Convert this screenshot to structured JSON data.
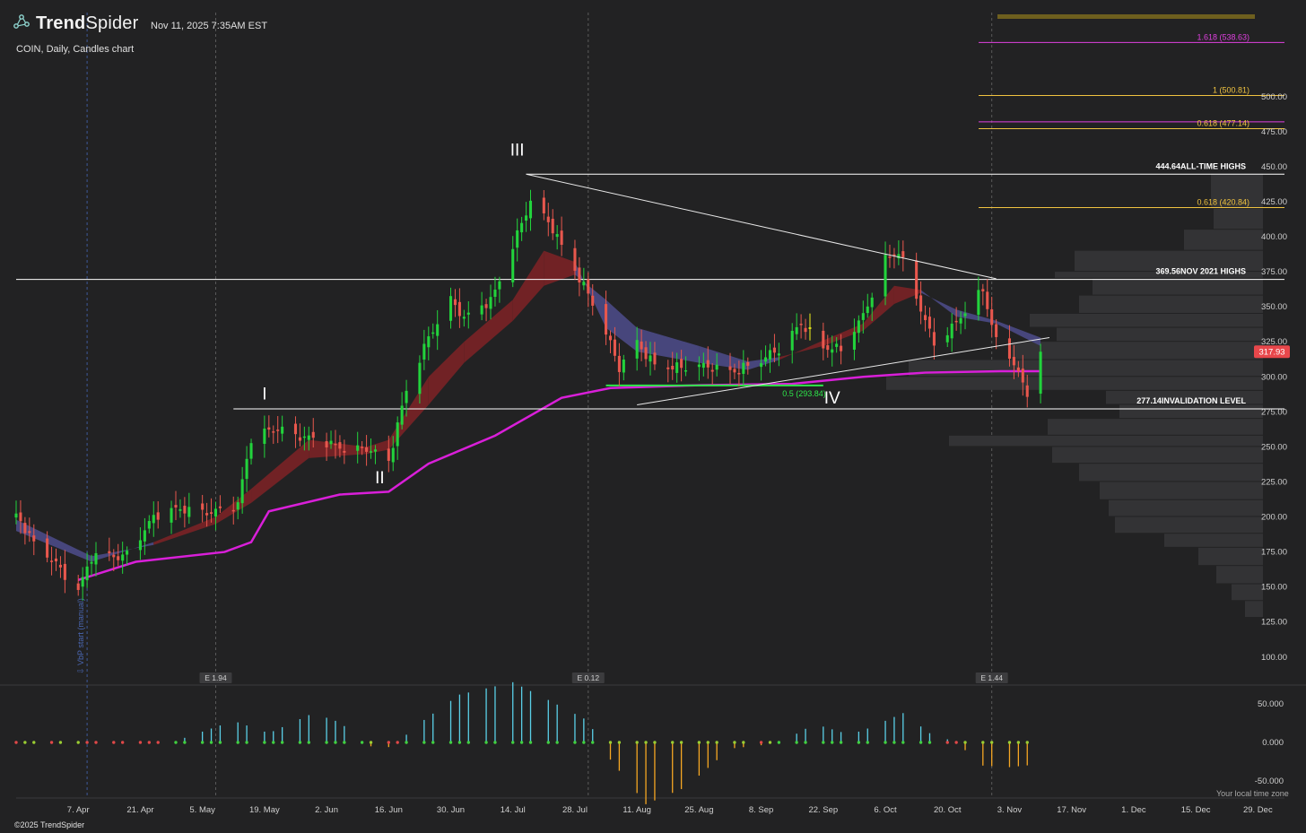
{
  "header": {
    "brand_prefix": "Trend",
    "brand_suffix": "Spider",
    "timestamp": "Nov 11, 2025 7:35AM EST",
    "symbol_line": "COIN, Daily, Candles chart",
    "logo_icon": "trendspider-network-icon"
  },
  "footer": {
    "timezone_note": "Your local time zone",
    "copyright": "©2025 TrendSpider"
  },
  "colors": {
    "background": "#222223",
    "bull": "#22d33c",
    "bear": "#e8574d",
    "vwap": "#d91fd9",
    "cloud_bull": "#4b4a86",
    "cloud_bear": "#7a2226",
    "fib_gold": "#f0c340",
    "fib_magenta": "#e040e0",
    "osc_pos": "#5ad0e8",
    "osc_neg": "#f5a623"
  },
  "chart_data": {
    "type": "candlestick",
    "ylim": [
      80,
      560
    ],
    "y_ticks": [
      100,
      125,
      150,
      175,
      200,
      225,
      250,
      275,
      300,
      325,
      350,
      375,
      400,
      425,
      450,
      475,
      500
    ],
    "y_tick_labels": [
      "100.00",
      "125.00",
      "150.00",
      "175.00",
      "200.00",
      "225.00",
      "250.00",
      "275.00",
      "300.00",
      "325.00",
      "350.00",
      "375.00",
      "400.00",
      "425.00",
      "450.00",
      "475.00",
      "500.00"
    ],
    "x_start": "2025-03-24",
    "x_end": "2026-01-04",
    "x_ticks": [
      "2025-04-07",
      "2025-04-21",
      "2025-05-05",
      "2025-05-19",
      "2025-06-02",
      "2025-06-16",
      "2025-06-30",
      "2025-07-14",
      "2025-07-28",
      "2025-08-11",
      "2025-08-25",
      "2025-09-08",
      "2025-09-22",
      "2025-10-06",
      "2025-10-20",
      "2025-11-03",
      "2025-11-17",
      "2025-12-01",
      "2025-12-15",
      "2025-12-29"
    ],
    "x_tick_labels": [
      "7. Apr",
      "21. Apr",
      "5. May",
      "19. May",
      "2. Jun",
      "16. Jun",
      "30. Jun",
      "14. Jul",
      "28. Jul",
      "11. Aug",
      "25. Aug",
      "8. Sep",
      "22. Sep",
      "6. Oct",
      "20. Oct",
      "3. Nov",
      "17. Nov",
      "1. Dec",
      "15. Dec",
      "29. Dec"
    ],
    "last_price": 317.93,
    "last_price_label": "317.93",
    "close_path": [
      [
        "2025-03-24",
        200
      ],
      [
        "2025-03-28",
        180
      ],
      [
        "2025-04-02",
        168
      ],
      [
        "2025-04-07",
        148
      ],
      [
        "2025-04-10",
        170
      ],
      [
        "2025-04-17",
        172
      ],
      [
        "2025-04-24",
        200
      ],
      [
        "2025-05-01",
        205
      ],
      [
        "2025-05-08",
        205
      ],
      [
        "2025-05-13",
        208
      ],
      [
        "2025-05-16",
        255
      ],
      [
        "2025-05-22",
        265
      ],
      [
        "2025-05-29",
        255
      ],
      [
        "2025-06-04",
        250
      ],
      [
        "2025-06-11",
        250
      ],
      [
        "2025-06-16",
        238
      ],
      [
        "2025-06-20",
        290
      ],
      [
        "2025-06-25",
        330
      ],
      [
        "2025-06-30",
        355
      ],
      [
        "2025-07-03",
        340
      ],
      [
        "2025-07-09",
        355
      ],
      [
        "2025-07-14",
        395
      ],
      [
        "2025-07-18",
        424
      ],
      [
        "2025-07-23",
        405
      ],
      [
        "2025-07-28",
        378
      ],
      [
        "2025-07-31",
        360
      ],
      [
        "2025-08-04",
        330
      ],
      [
        "2025-08-07",
        305
      ],
      [
        "2025-08-11",
        325
      ],
      [
        "2025-08-15",
        310
      ],
      [
        "2025-08-21",
        305
      ],
      [
        "2025-08-28",
        308
      ],
      [
        "2025-09-03",
        305
      ],
      [
        "2025-09-08",
        310
      ],
      [
        "2025-09-12",
        320
      ],
      [
        "2025-09-17",
        340
      ],
      [
        "2025-09-22",
        320
      ],
      [
        "2025-09-26",
        318
      ],
      [
        "2025-10-01",
        345
      ],
      [
        "2025-10-06",
        385
      ],
      [
        "2025-10-09",
        388
      ],
      [
        "2025-10-13",
        355
      ],
      [
        "2025-10-17",
        325
      ],
      [
        "2025-10-22",
        340
      ],
      [
        "2025-10-28",
        360
      ],
      [
        "2025-10-31",
        325
      ],
      [
        "2025-11-04",
        312
      ],
      [
        "2025-11-07",
        288
      ],
      [
        "2025-11-10",
        317.93
      ]
    ],
    "highlight_candle": {
      "date": "2025-09-19",
      "color": "#f5f51a"
    },
    "ema_cloud": [
      [
        "2025-03-24",
        198,
        190
      ],
      [
        "2025-04-10",
        172,
        168
      ],
      [
        "2025-04-24",
        180,
        182
      ],
      [
        "2025-05-08",
        195,
        200
      ],
      [
        "2025-05-16",
        210,
        220
      ],
      [
        "2025-05-29",
        242,
        255
      ],
      [
        "2025-06-11",
        245,
        250
      ],
      [
        "2025-06-16",
        248,
        255
      ],
      [
        "2025-06-25",
        280,
        300
      ],
      [
        "2025-07-03",
        310,
        325
      ],
      [
        "2025-07-14",
        340,
        355
      ],
      [
        "2025-07-21",
        365,
        390
      ],
      [
        "2025-07-28",
        373,
        382
      ],
      [
        "2025-08-04",
        355,
        335
      ],
      [
        "2025-08-11",
        335,
        318
      ],
      [
        "2025-08-25",
        322,
        310
      ],
      [
        "2025-09-05",
        311,
        305
      ],
      [
        "2025-09-12",
        314,
        312
      ],
      [
        "2025-09-22",
        322,
        326
      ],
      [
        "2025-10-01",
        333,
        338
      ],
      [
        "2025-10-08",
        352,
        365
      ],
      [
        "2025-10-14",
        360,
        362
      ],
      [
        "2025-10-22",
        348,
        343
      ],
      [
        "2025-10-31",
        340,
        338
      ],
      [
        "2025-11-10",
        328,
        322
      ]
    ],
    "vwap": [
      [
        "2025-04-07",
        155
      ],
      [
        "2025-04-20",
        168
      ],
      [
        "2025-05-10",
        175
      ],
      [
        "2025-05-16",
        182
      ],
      [
        "2025-05-20",
        204
      ],
      [
        "2025-06-05",
        216
      ],
      [
        "2025-06-16",
        218
      ],
      [
        "2025-06-25",
        238
      ],
      [
        "2025-07-10",
        258
      ],
      [
        "2025-07-25",
        285
      ],
      [
        "2025-08-05",
        292
      ],
      [
        "2025-08-25",
        294
      ],
      [
        "2025-09-15",
        295
      ],
      [
        "2025-10-01",
        300
      ],
      [
        "2025-10-15",
        303
      ],
      [
        "2025-11-01",
        304
      ],
      [
        "2025-11-10",
        304
      ]
    ],
    "horizontal_levels": [
      {
        "value": 444.64,
        "price": "444.64",
        "label": "ALL-TIME HIGHS",
        "color": "#ffffff",
        "from": "2025-07-17"
      },
      {
        "value": 369.56,
        "price": "369.56",
        "label": "NOV 2021 HIGHS",
        "color": "#ffffff",
        "from": "2025-03-24"
      },
      {
        "value": 277.14,
        "price": "277.14",
        "label": "INVALIDATION LEVEL",
        "color": "#ffffff",
        "from": "2025-05-12"
      }
    ],
    "fib_levels": [
      {
        "value": 538.63,
        "label": "1.618 (538.63)",
        "color": "#e040e0"
      },
      {
        "value": 500.81,
        "label": "1 (500.81)",
        "color": "#f0c340"
      },
      {
        "value": 482.0,
        "label": "",
        "color": "#e040e0"
      },
      {
        "value": 477.14,
        "label": "0.618 (477.14)",
        "color": "#f0c340"
      },
      {
        "value": 420.84,
        "label": "0.618 (420.84)",
        "color": "#f0c340"
      }
    ],
    "fib_green": {
      "value": 293.84,
      "label": "0.5 (293.84)",
      "from": "2025-08-04",
      "to": "2025-09-22"
    },
    "trendlines": [
      {
        "from": [
          "2025-07-17",
          444.64
        ],
        "to": [
          "2025-10-31",
          370
        ]
      },
      {
        "from": [
          "2025-08-11",
          280
        ],
        "to": [
          "2025-11-12",
          328
        ]
      }
    ],
    "wave_labels": [
      {
        "text": "I",
        "date": "2025-05-19",
        "value": 284
      },
      {
        "text": "II",
        "date": "2025-06-14",
        "value": 224
      },
      {
        "text": "III",
        "date": "2025-07-15",
        "value": 458
      },
      {
        "text": "IV",
        "date": "2025-09-24",
        "value": 281
      }
    ],
    "earnings": [
      {
        "label": "E 1.94",
        "date": "2025-05-08"
      },
      {
        "label": "E 0.12",
        "date": "2025-07-31"
      },
      {
        "label": "E 1.44",
        "date": "2025-10-30"
      }
    ],
    "vbp_note": "VbP start (manual)",
    "vbp_start": "2025-04-09",
    "volume_profile": [
      [
        445,
        58
      ],
      [
        420,
        55
      ],
      [
        405,
        88
      ],
      [
        390,
        210
      ],
      [
        375,
        232
      ],
      [
        370,
        190
      ],
      [
        358,
        205
      ],
      [
        345,
        260
      ],
      [
        335,
        230
      ],
      [
        325,
        280
      ],
      [
        312,
        395
      ],
      [
        300,
        420
      ],
      [
        290,
        175
      ],
      [
        280,
        160
      ],
      [
        270,
        240
      ],
      [
        258,
        350
      ],
      [
        250,
        235
      ],
      [
        238,
        205
      ],
      [
        225,
        182
      ],
      [
        212,
        172
      ],
      [
        200,
        165
      ],
      [
        188,
        110
      ],
      [
        178,
        72
      ],
      [
        165,
        52
      ],
      [
        152,
        35
      ],
      [
        140,
        20
      ]
    ],
    "oscillator": {
      "ylim": [
        -72,
        72
      ],
      "ticks": [
        50,
        0,
        -50
      ],
      "tick_labels": [
        "50.000",
        "0.000",
        "-50.000"
      ],
      "path": [
        [
          "2025-03-24",
          -2
        ],
        [
          "2025-04-28",
          0
        ],
        [
          "2025-05-01",
          6
        ],
        [
          "2025-05-12",
          28
        ],
        [
          "2025-05-20",
          12
        ],
        [
          "2025-05-30",
          38
        ],
        [
          "2025-06-05",
          26
        ],
        [
          "2025-06-10",
          2
        ],
        [
          "2025-06-14",
          -12
        ],
        [
          "2025-06-18",
          0
        ],
        [
          "2025-06-23",
          25
        ],
        [
          "2025-07-02",
          62
        ],
        [
          "2025-07-14",
          78
        ],
        [
          "2025-07-21",
          58
        ],
        [
          "2025-07-31",
          28
        ],
        [
          "2025-08-04",
          -15
        ],
        [
          "2025-08-13",
          -80
        ],
        [
          "2025-08-22",
          -58
        ],
        [
          "2025-09-01",
          -8
        ],
        [
          "2025-09-09",
          -3
        ],
        [
          "2025-09-14",
          5
        ],
        [
          "2025-09-20",
          24
        ],
        [
          "2025-09-28",
          10
        ],
        [
          "2025-10-02",
          18
        ],
        [
          "2025-10-10",
          38
        ],
        [
          "2025-10-16",
          12
        ],
        [
          "2025-10-22",
          0
        ],
        [
          "2025-10-28",
          -30
        ],
        [
          "2025-11-03",
          -32
        ],
        [
          "2025-11-10",
          -28
        ]
      ]
    }
  }
}
